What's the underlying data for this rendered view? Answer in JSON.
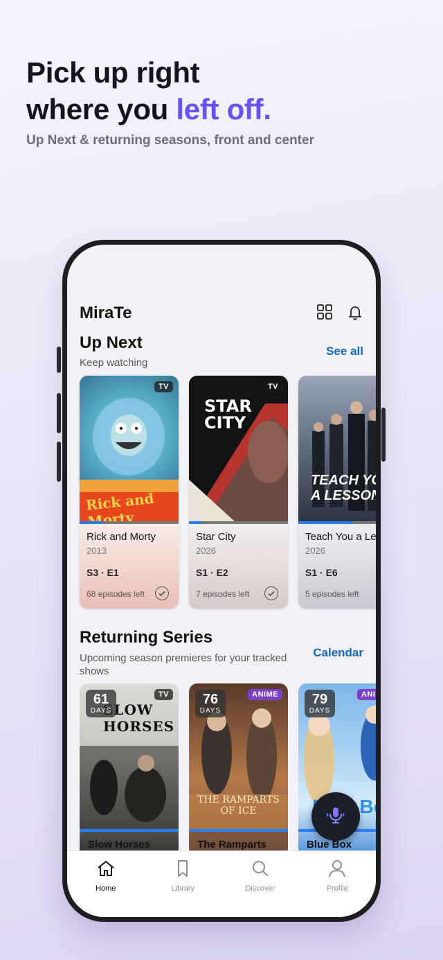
{
  "hero": {
    "line1": "Pick up right",
    "line2_prefix": "where you ",
    "line2_accent": "left off.",
    "subtitle": "Up Next & returning seasons, front and center",
    "accent_color": "#6c4ff0"
  },
  "app": {
    "name": "MiraTe"
  },
  "up_next": {
    "title": "Up Next",
    "subtitle": "Keep watching",
    "link": "See all",
    "cards": [
      {
        "badge": "TV",
        "title": "Rick and Morty",
        "year": "2013",
        "episode": "S3 · E1",
        "left": "68 episodes left",
        "progress": 0.24,
        "poster_text": "Rick and Morty"
      },
      {
        "badge": "TV",
        "title": "Star City",
        "year": "2026",
        "episode": "S1 · E2",
        "left": "7 episodes left",
        "progress": 0.13,
        "poster_text": "STAR CITY"
      },
      {
        "badge": "",
        "title": "Teach You a Lesson",
        "year": "2026",
        "episode": "S1 · E6",
        "left": "5 episodes left",
        "progress": 0.55,
        "poster_text": "TEACH YOU A LESSON"
      }
    ]
  },
  "returning": {
    "title": "Returning Series",
    "subtitle": "Upcoming season premieres for your tracked shows",
    "link": "Calendar",
    "cards": [
      {
        "days": "61",
        "days_label": "DAYS",
        "badge": "TV",
        "title": "Slow Horses",
        "poster_text": "SLOW HORSES"
      },
      {
        "days": "76",
        "days_label": "DAYS",
        "badge": "ANIME",
        "title": "The Ramparts",
        "poster_text": "THE RAMPARTS OF ICE"
      },
      {
        "days": "79",
        "days_label": "DAYS",
        "badge": "ANIME",
        "title": "Blue Box",
        "poster_text": "Blue Box"
      }
    ]
  },
  "tabs": [
    {
      "label": "Home",
      "icon": "home-icon",
      "active": true
    },
    {
      "label": "Library",
      "icon": "bookmark-icon",
      "active": false
    },
    {
      "label": "Discover",
      "icon": "search-icon",
      "active": false
    },
    {
      "label": "Profile",
      "icon": "person-icon",
      "active": false
    }
  ]
}
